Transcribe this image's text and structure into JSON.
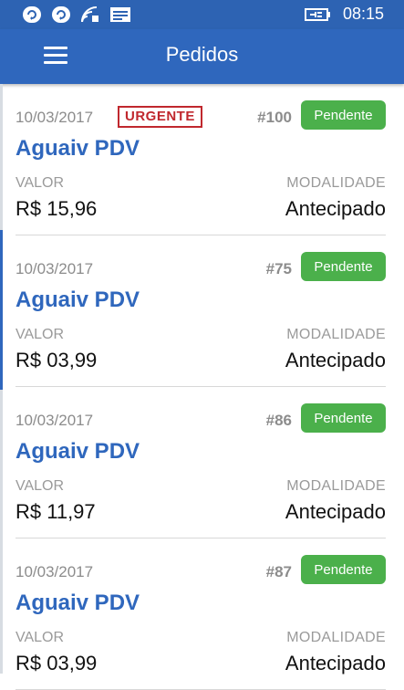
{
  "status_bar": {
    "time": "08:15"
  },
  "app_bar": {
    "title": "Pedidos"
  },
  "labels": {
    "valor": "VALOR",
    "modalidade": "MODALIDADE"
  },
  "colors": {
    "primary": "#2f67bd",
    "status_green": "#4bb04b",
    "urgent_red": "#c0282e"
  },
  "orders": [
    {
      "date": "10/03/2017",
      "urgent": "URGENTE",
      "number": "#100",
      "status": "Pendente",
      "client": "Aguaiv PDV",
      "value": "R$ 15,96",
      "modality": "Antecipado"
    },
    {
      "date": "10/03/2017",
      "number": "#75",
      "status": "Pendente",
      "client": "Aguaiv PDV",
      "value": "R$ 03,99",
      "modality": "Antecipado"
    },
    {
      "date": "10/03/2017",
      "number": "#86",
      "status": "Pendente",
      "client": "Aguaiv PDV",
      "value": "R$ 11,97",
      "modality": "Antecipado"
    },
    {
      "date": "10/03/2017",
      "number": "#87",
      "status": "Pendente",
      "client": "Aguaiv PDV",
      "value": "R$ 03,99",
      "modality": "Antecipado"
    }
  ]
}
